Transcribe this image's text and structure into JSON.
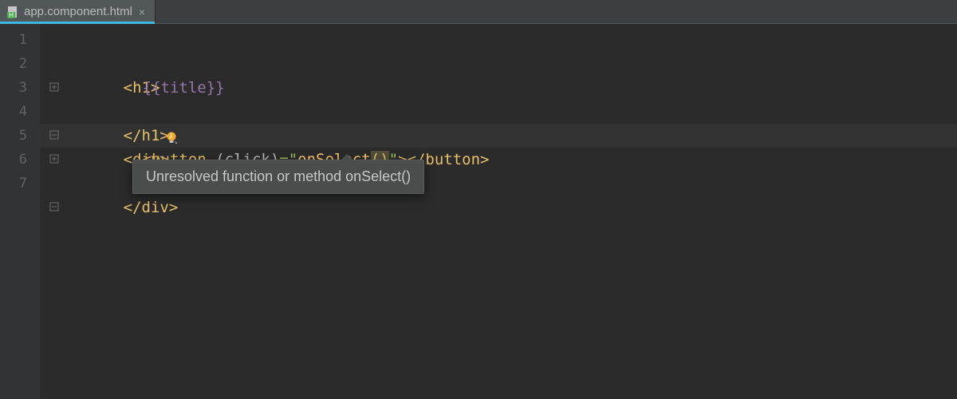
{
  "tab": {
    "filename": "app.component.html",
    "close_glyph": "×",
    "icon_badge": "H"
  },
  "gutter": {
    "lines": [
      "1",
      "2",
      "3",
      "4",
      "5",
      "6",
      "7"
    ]
  },
  "code": {
    "l1": {
      "open_lt": "<",
      "tag": "h1",
      "close_gt": ">"
    },
    "l2": {
      "expr": "{{title}}"
    },
    "l3": {
      "open_lt": "</",
      "tag": "h1",
      "close_gt": ">"
    },
    "l4": {
      "open_lt": "<",
      "tag": "div",
      "close_gt": ">"
    },
    "l5": {
      "open_lt": "<",
      "tag": "button",
      "space": " ",
      "attr": "(click)",
      "eq": "=",
      "q1": "\"",
      "func": "onSelect",
      "p1": "(",
      "p2": ")",
      "q2": "\"",
      "close1": ">",
      "end_open": "</",
      "end_tag": "button",
      "end_close": ">"
    },
    "l6": {
      "open_lt": "</",
      "tag": "div",
      "close_gt": ">"
    }
  },
  "tooltip": {
    "text": "Unresolved function or method onSelect()"
  }
}
